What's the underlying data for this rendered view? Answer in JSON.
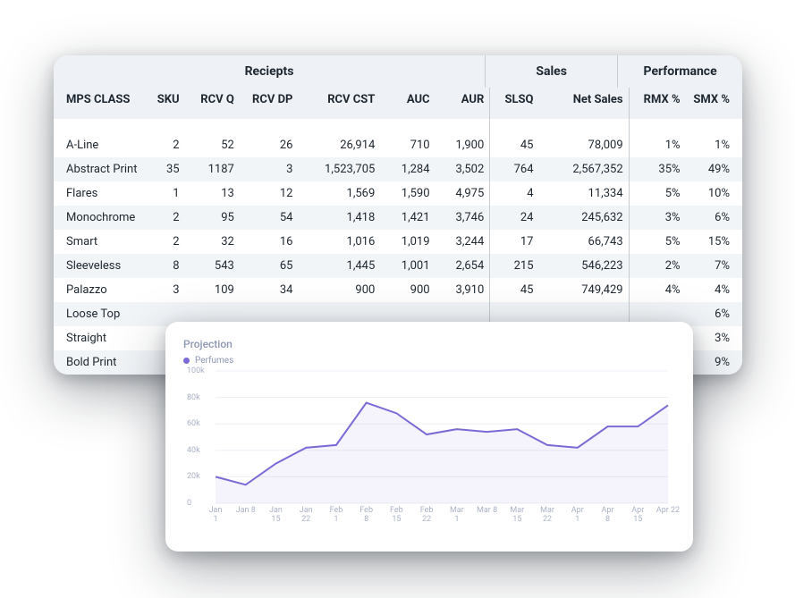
{
  "table": {
    "groups": {
      "receipts": "Reciepts",
      "sales": "Sales",
      "performance": "Performance"
    },
    "headers": {
      "mps_class": "MPS CLASS",
      "sku": "SKU",
      "rcvq": "RCV Q",
      "rcvdp": "RCV DP",
      "rcvcst": "RCV CST",
      "auc": "AUC",
      "aur": "AUR",
      "slsq": "SLSQ",
      "net_sales": "Net Sales",
      "rmx": "RMX %",
      "smx": "SMX %"
    },
    "rows": [
      {
        "mps_class": "A-Line",
        "sku": "2",
        "rcvq": "52",
        "rcvdp": "26",
        "rcvcst": "26,914",
        "auc": "710",
        "aur": "1,900",
        "slsq": "45",
        "net_sales": "78,009",
        "rmx": "1%",
        "smx": "1%"
      },
      {
        "mps_class": "Abstract Print",
        "sku": "35",
        "rcvq": "1187",
        "rcvdp": "3",
        "rcvcst": "1,523,705",
        "auc": "1,284",
        "aur": "3,502",
        "slsq": "764",
        "net_sales": "2,567,352",
        "rmx": "35%",
        "smx": "49%"
      },
      {
        "mps_class": "Flares",
        "sku": "1",
        "rcvq": "13",
        "rcvdp": "12",
        "rcvcst": "1,569",
        "auc": "1,590",
        "aur": "4,975",
        "slsq": "4",
        "net_sales": "11,334",
        "rmx": "5%",
        "smx": "10%"
      },
      {
        "mps_class": "Monochrome",
        "sku": "2",
        "rcvq": "95",
        "rcvdp": "54",
        "rcvcst": "1,418",
        "auc": "1,421",
        "aur": "3,746",
        "slsq": "24",
        "net_sales": "245,632",
        "rmx": "3%",
        "smx": "6%"
      },
      {
        "mps_class": "Smart",
        "sku": "2",
        "rcvq": "32",
        "rcvdp": "16",
        "rcvcst": "1,016",
        "auc": "1,019",
        "aur": "3,244",
        "slsq": "17",
        "net_sales": "66,743",
        "rmx": "5%",
        "smx": "15%"
      },
      {
        "mps_class": "Sleeveless",
        "sku": "8",
        "rcvq": "543",
        "rcvdp": "65",
        "rcvcst": "1,445",
        "auc": "1,001",
        "aur": "2,654",
        "slsq": "215",
        "net_sales": "546,223",
        "rmx": "2%",
        "smx": "7%"
      },
      {
        "mps_class": "Palazzo",
        "sku": "3",
        "rcvq": "109",
        "rcvdp": "34",
        "rcvcst": "900",
        "auc": "900",
        "aur": "3,910",
        "slsq": "45",
        "net_sales": "749,429",
        "rmx": "4%",
        "smx": "4%"
      },
      {
        "mps_class": "Loose Top",
        "sku": "",
        "rcvq": "",
        "rcvdp": "",
        "rcvcst": "",
        "auc": "",
        "aur": "",
        "slsq": "",
        "net_sales": "",
        "rmx": "",
        "smx": "6%"
      },
      {
        "mps_class": "Straight",
        "sku": "",
        "rcvq": "",
        "rcvdp": "",
        "rcvcst": "",
        "auc": "",
        "aur": "",
        "slsq": "",
        "net_sales": "",
        "rmx": "",
        "smx": "3%"
      },
      {
        "mps_class": "Bold Print",
        "sku": "",
        "rcvq": "",
        "rcvdp": "",
        "rcvcst": "",
        "auc": "",
        "aur": "",
        "slsq": "",
        "net_sales": "",
        "rmx": "",
        "smx": "9%"
      }
    ]
  },
  "chart": {
    "title": "Projection",
    "legend": "Perfumes"
  },
  "chart_data": {
    "type": "line",
    "title": "Projection",
    "series_name": "Perfumes",
    "ylim": [
      0,
      100000
    ],
    "yticks": [
      0,
      20000,
      40000,
      60000,
      80000,
      100000
    ],
    "ytick_labels": [
      "0",
      "20k",
      "40k",
      "60k",
      "80k",
      "100k"
    ],
    "categories": [
      "Jan\n1",
      "Jan 8",
      "Jan\n15",
      "Jan\n22",
      "Feb\n1",
      "Feb\n8",
      "Feb\n15",
      "Feb\n22",
      "Mar\n1",
      "Mar 8",
      "Mar\n15",
      "Mar\n22",
      "Apr\n1",
      "Apr\n8",
      "Apr\n15",
      "Apr 22"
    ],
    "values": [
      20000,
      14000,
      30000,
      42000,
      44000,
      76000,
      68000,
      52000,
      56000,
      54000,
      56000,
      44000,
      42000,
      58000,
      58000,
      74000
    ]
  }
}
